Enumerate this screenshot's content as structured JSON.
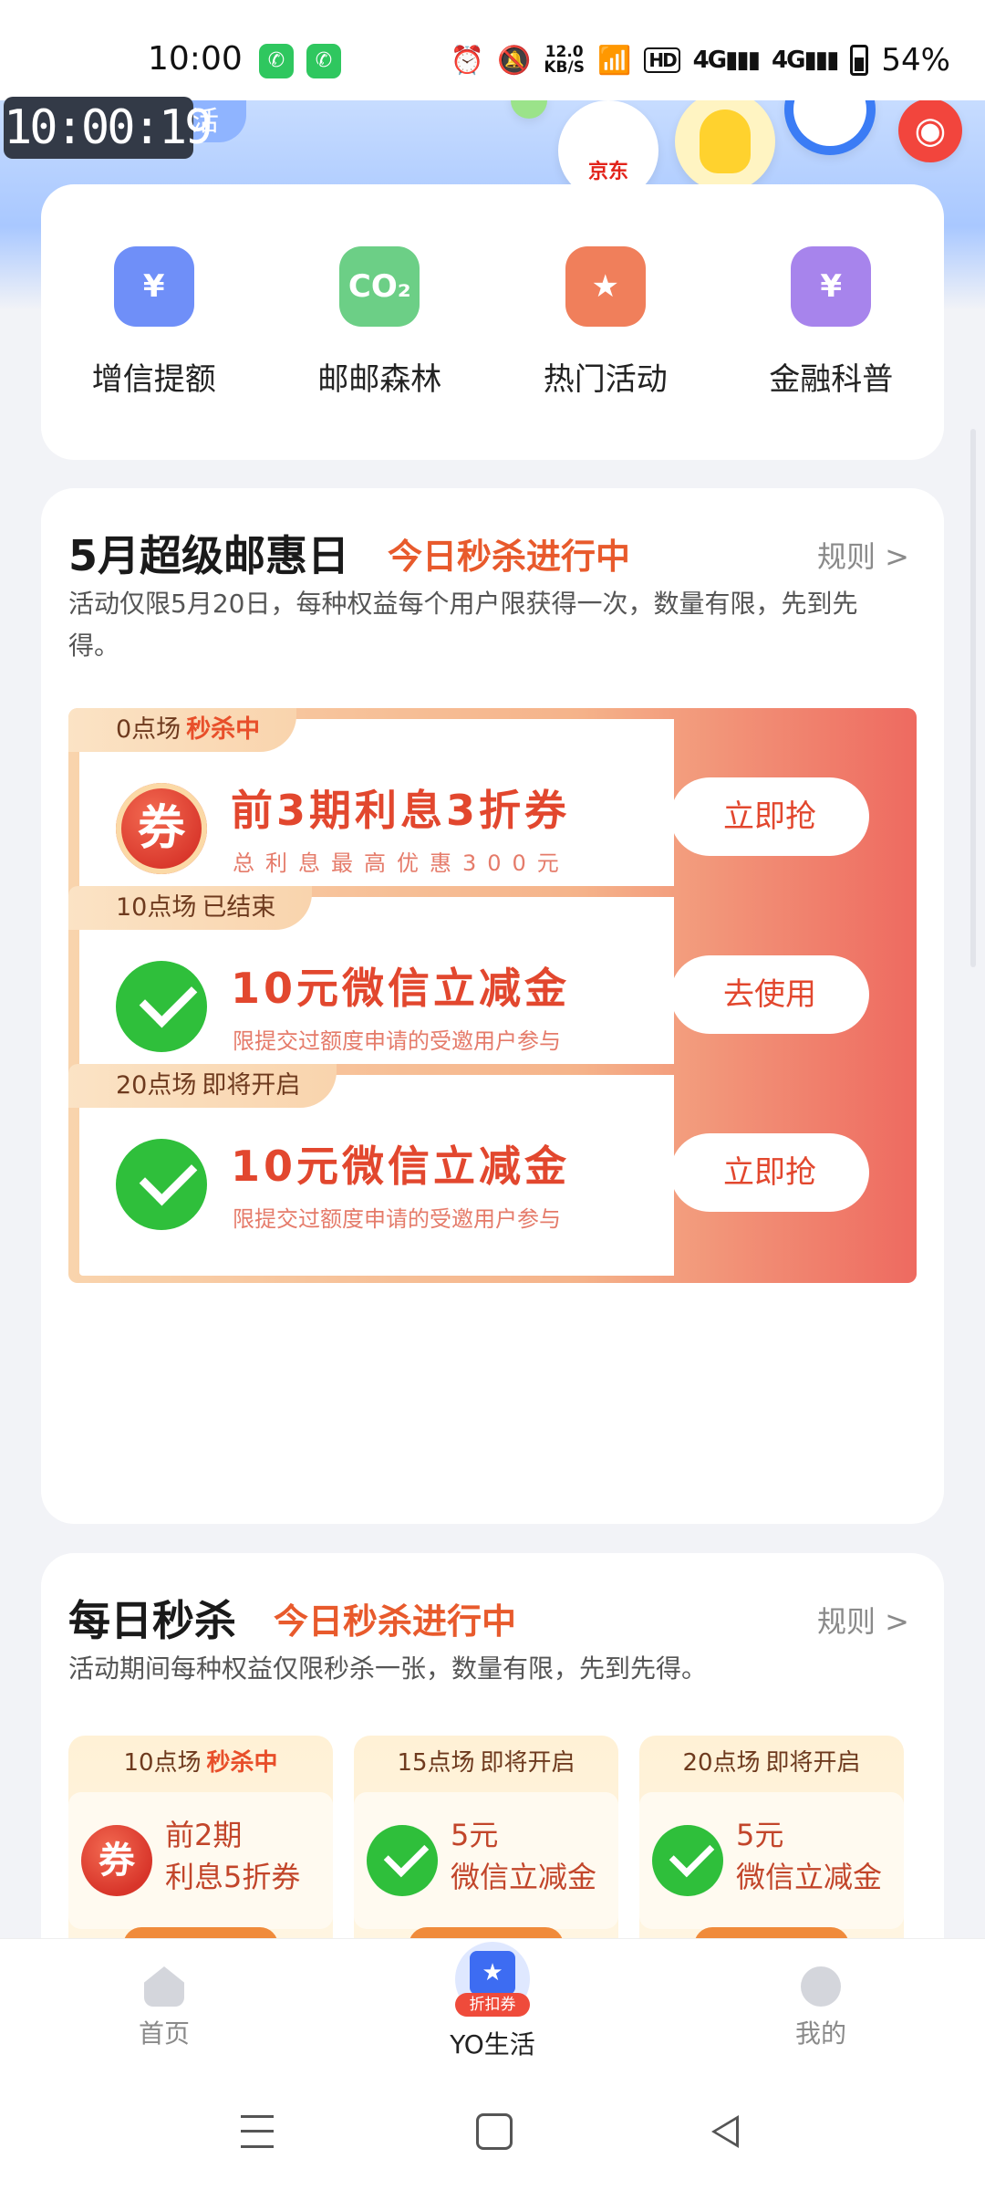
{
  "status_bar": {
    "time": "10:00",
    "network_speed": "12.0",
    "network_unit": "KB/S",
    "hd_label": "HD",
    "signal_1": "4G",
    "signal_2": "4G",
    "battery": "54%"
  },
  "overlay_timer": "10:00:19",
  "banner": {
    "slogan": "有趣生活",
    "partner_label": "京东"
  },
  "quick_menu": [
    {
      "label": "增信提额",
      "icon": "wallet-icon",
      "color": "#6f8ff8",
      "glyph": "¥"
    },
    {
      "label": "邮邮森林",
      "icon": "co2-leaf-icon",
      "color": "#6ccf86",
      "glyph": "CO₂"
    },
    {
      "label": "热门活动",
      "icon": "bookmark-star-icon",
      "color": "#f07f5b",
      "glyph": "★"
    },
    {
      "label": "金融科普",
      "icon": "finance-search-icon",
      "color": "#a784ec",
      "glyph": "¥"
    }
  ],
  "super_day": {
    "title": "5月超级邮惠日",
    "live_label": "今日秒杀进行中",
    "rule_link": "规则 >",
    "description": "活动仅限5月20日，每种权益每个用户限获得一次，数量有限，先到先得。",
    "coupons": [
      {
        "session": "0点场",
        "status": "秒杀中",
        "status_hot": true,
        "icon": "quan",
        "icon_text": "券",
        "title": "前3期利息3折券",
        "subtitle": "总利息最高优惠300元",
        "button": "立即抢"
      },
      {
        "session": "10点场",
        "status": "已结束",
        "status_hot": false,
        "icon": "wx",
        "icon_text": "",
        "title": "10元微信立减金",
        "subtitle": "限提交过额度申请的受邀用户参与",
        "button": "去使用"
      },
      {
        "session": "20点场",
        "status": "即将开启",
        "status_hot": false,
        "icon": "wx",
        "icon_text": "",
        "title": "10元微信立减金",
        "subtitle": "限提交过额度申请的受邀用户参与",
        "button": "立即抢"
      }
    ]
  },
  "daily_flash": {
    "title": "每日秒杀",
    "live_label": "今日秒杀进行中",
    "rule_link": "规则 >",
    "description": "活动期间每种权益仅限秒杀一张，数量有限，先到先得。",
    "items": [
      {
        "session": "10点场",
        "status": "秒杀中",
        "status_hot": true,
        "icon": "quan",
        "icon_text": "券",
        "line1": "前2期",
        "line2": "利息5折券"
      },
      {
        "session": "15点场",
        "status": "即将开启",
        "status_hot": false,
        "icon": "wx",
        "icon_text": "",
        "line1": "5元",
        "line2": "微信立减金"
      },
      {
        "session": "20点场",
        "status": "即将开启",
        "status_hot": false,
        "icon": "wx",
        "icon_text": "",
        "line1": "5元",
        "line2": "微信立减金"
      }
    ]
  },
  "bottom_nav": {
    "home": "首页",
    "yo_life": "YO生活",
    "yo_badge": "折扣券",
    "mine": "我的"
  }
}
